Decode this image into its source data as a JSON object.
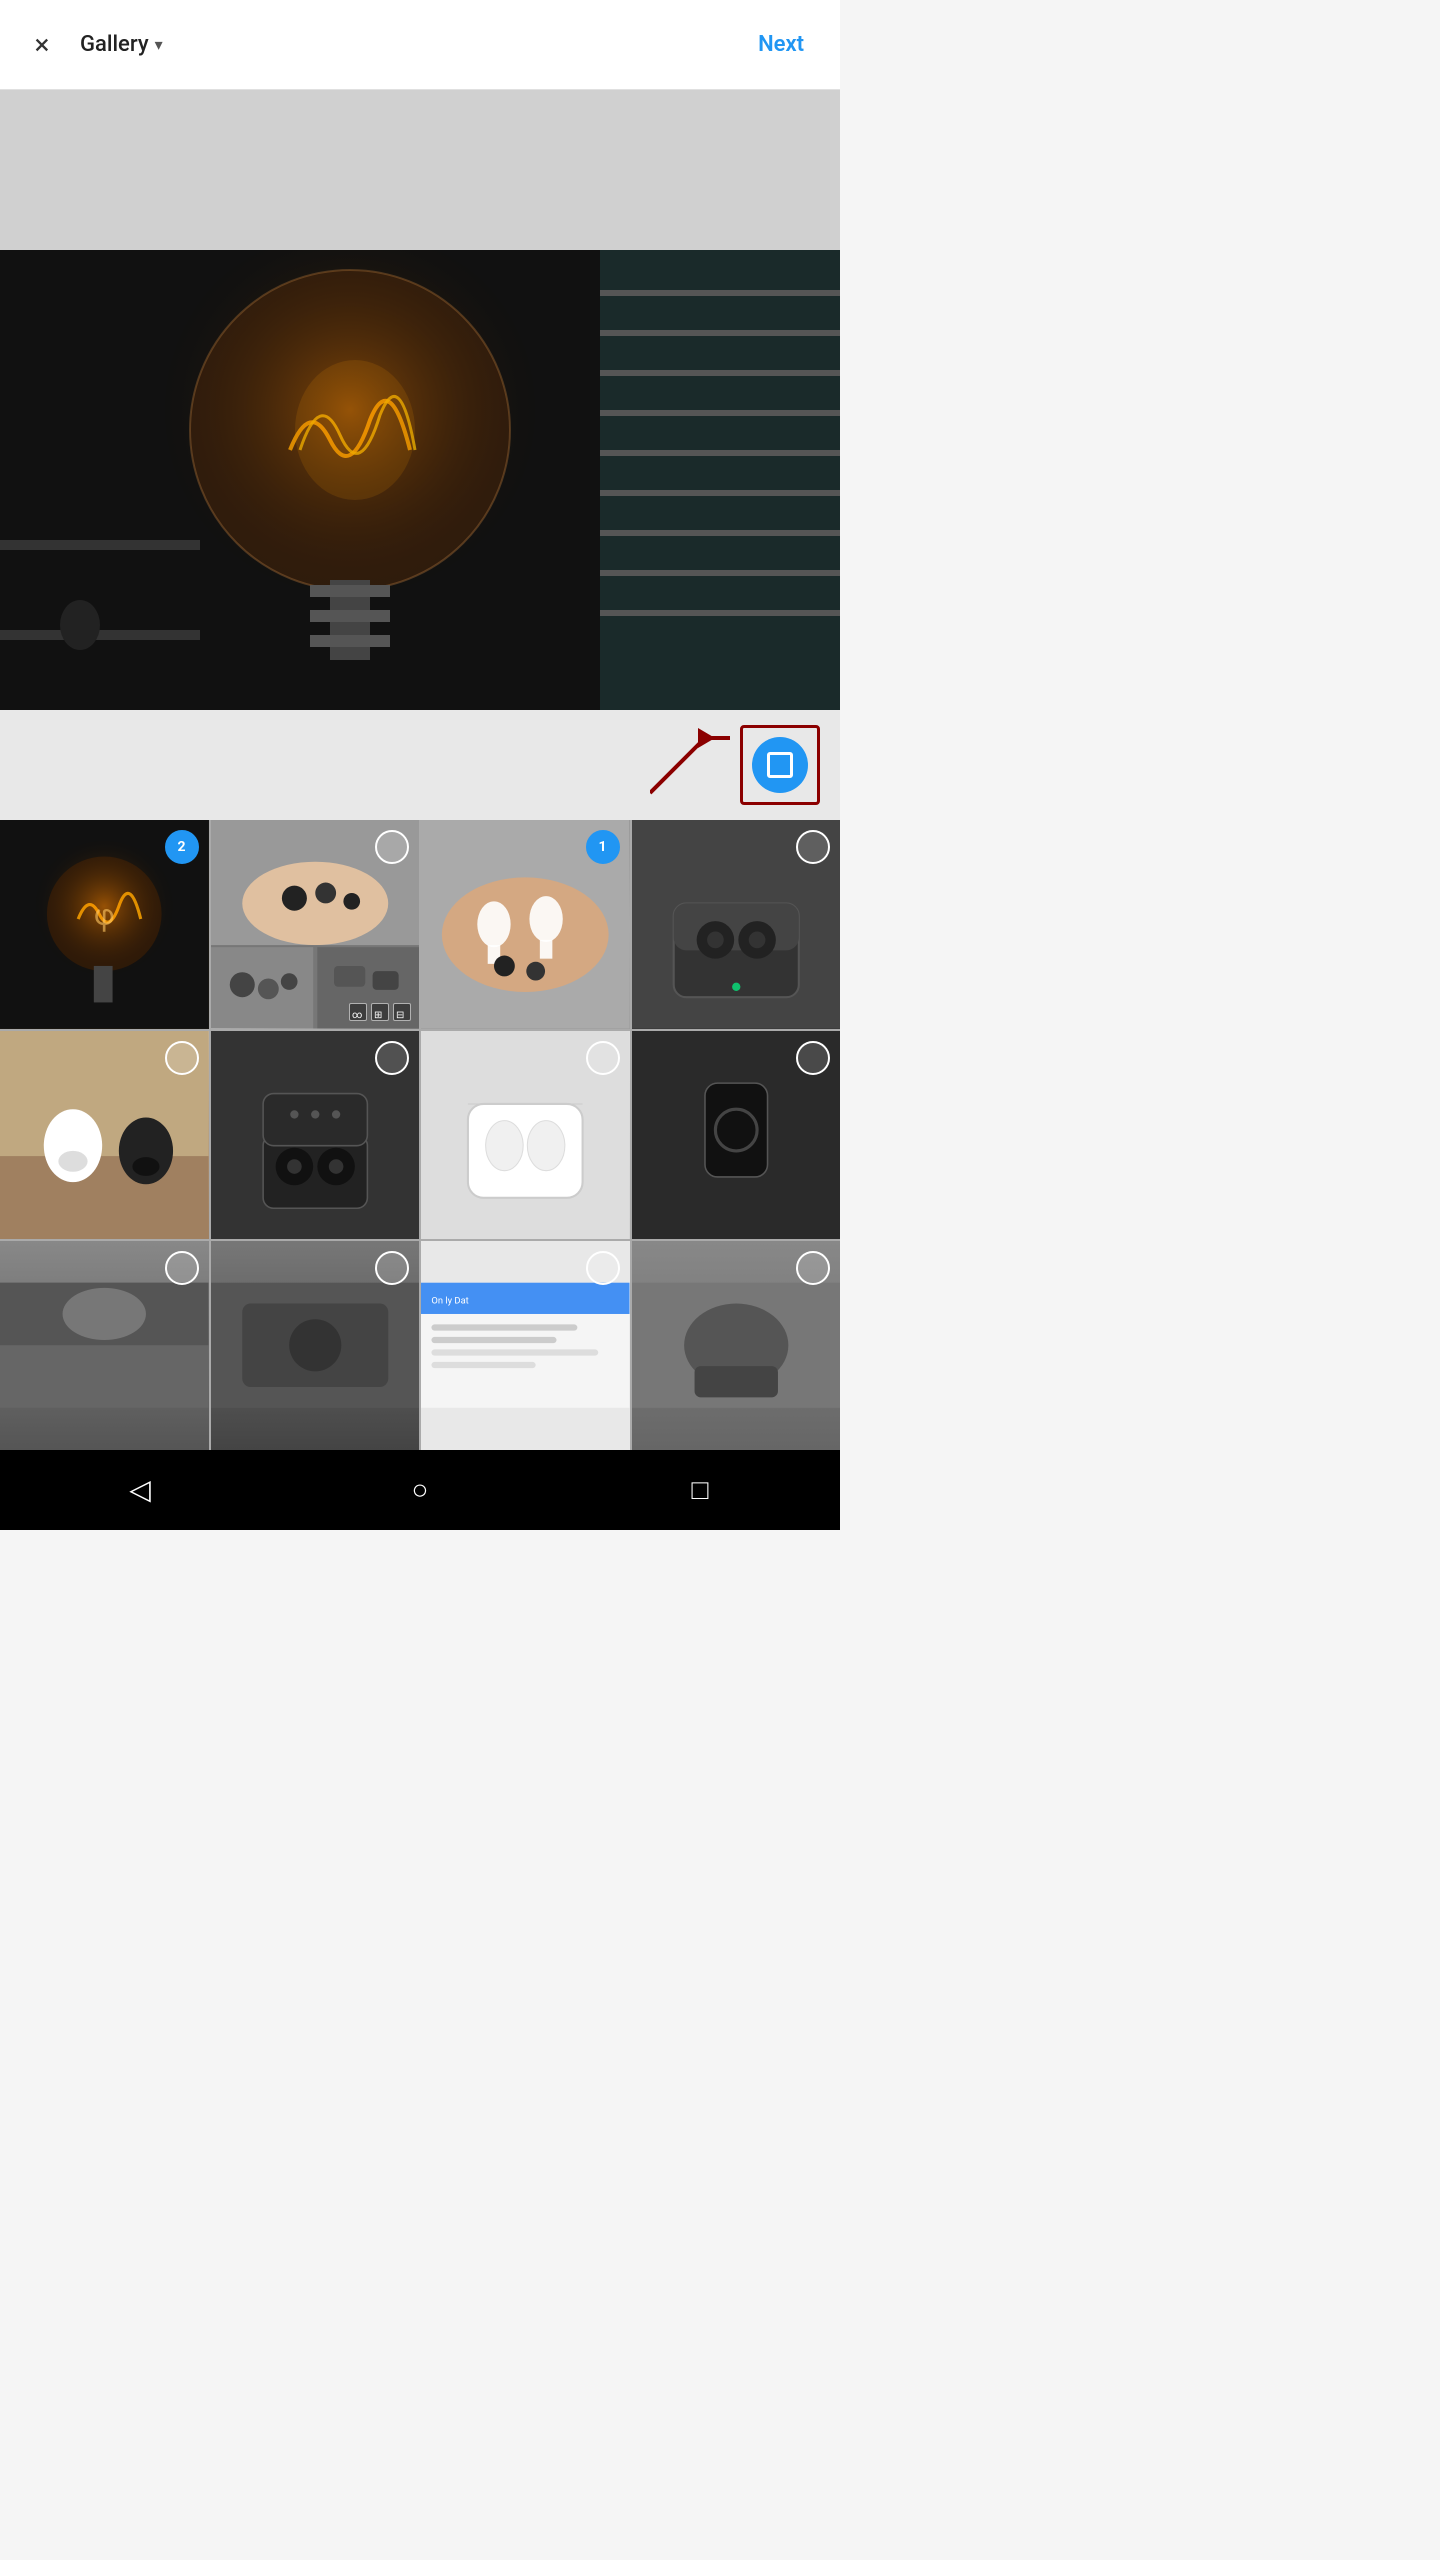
{
  "header": {
    "close_label": "×",
    "gallery_label": "Gallery",
    "chevron": "▾",
    "next_label": "Next"
  },
  "preview": {
    "placeholder": "Light bulb photo"
  },
  "crop_tool": {
    "icon_label": "Crop/Resize"
  },
  "thumbnails": [
    {
      "id": 1,
      "label": "Light bulb",
      "selected": true,
      "selection_number": "2",
      "class": "thumb-bulb"
    },
    {
      "id": 2,
      "label": "Earbuds in hand collage",
      "selected": false,
      "selection_number": "",
      "class": "thumb-earbuds-hand-2"
    },
    {
      "id": 3,
      "label": "AirPods in hand",
      "selected": true,
      "selection_number": "1",
      "class": "thumb-airpods-hand"
    },
    {
      "id": 4,
      "label": "Earbuds in case",
      "selected": false,
      "selection_number": "",
      "class": "thumb-earbuds-case"
    },
    {
      "id": 5,
      "label": "Earbuds on table",
      "selected": false,
      "selection_number": "",
      "class": "thumb-earbuds-table"
    },
    {
      "id": 6,
      "label": "Black earbuds open",
      "selected": false,
      "selection_number": "",
      "class": "thumb-black-earbuds"
    },
    {
      "id": 7,
      "label": "White earbuds",
      "selected": false,
      "selection_number": "",
      "class": "thumb-white-earbuds"
    },
    {
      "id": 8,
      "label": "Black earbuds case",
      "selected": false,
      "selection_number": "",
      "class": "thumb-black-case"
    },
    {
      "id": 9,
      "label": "Partial image 1",
      "selected": false,
      "selection_number": "",
      "class": "thumb-partial-1"
    },
    {
      "id": 10,
      "label": "Partial image 2",
      "selected": false,
      "selection_number": "",
      "class": "thumb-partial-2"
    },
    {
      "id": 11,
      "label": "Partial image 3",
      "selected": false,
      "selection_number": "",
      "class": "thumb-partial-3"
    },
    {
      "id": 12,
      "label": "Partial image 4",
      "selected": false,
      "selection_number": "",
      "class": "thumb-partial-4"
    }
  ],
  "nav_bar": {
    "back_icon": "◁",
    "home_icon": "○",
    "recent_icon": "□"
  }
}
